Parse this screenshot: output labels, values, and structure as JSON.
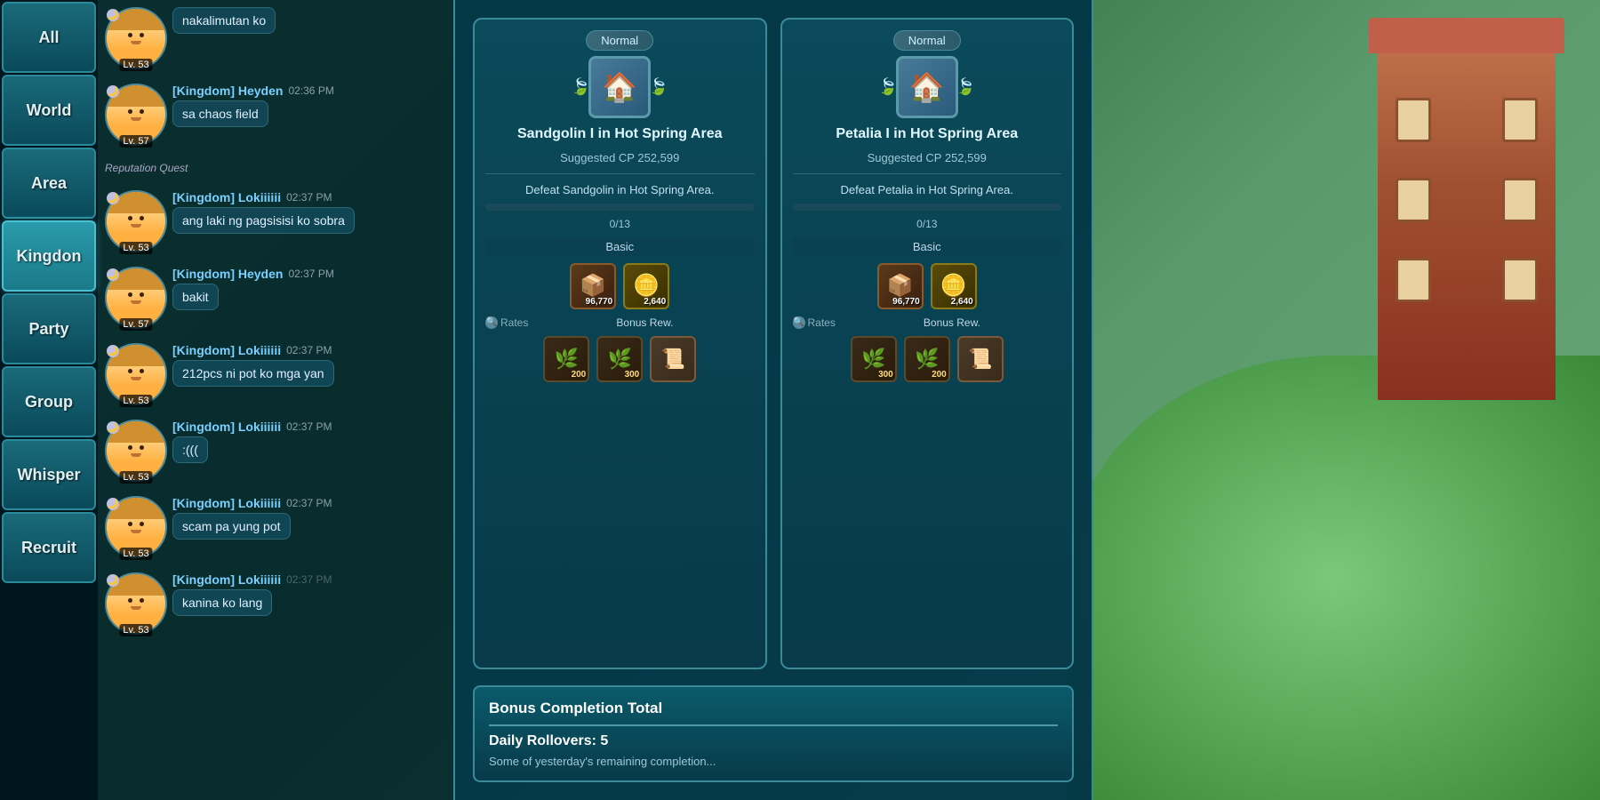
{
  "game_bg": {
    "description": "Fantasy game world background with grass and buildings"
  },
  "chat_tabs": [
    {
      "id": "all",
      "label": "All",
      "active": false
    },
    {
      "id": "world",
      "label": "World",
      "active": false
    },
    {
      "id": "area",
      "label": "Area",
      "active": false
    },
    {
      "id": "kingdom",
      "label": "Kingdon",
      "active": true
    },
    {
      "id": "party",
      "label": "Party",
      "active": false
    },
    {
      "id": "group",
      "label": "Group",
      "active": false
    },
    {
      "id": "whisper",
      "label": "Whisper",
      "active": false
    },
    {
      "id": "recruit",
      "label": "Recruit",
      "active": false
    }
  ],
  "chat_messages": [
    {
      "id": 1,
      "avatar_level": "Lv. 53",
      "message_text": "nakalimutan ko",
      "time": ""
    },
    {
      "id": 2,
      "name": "[Kingdom] Heyden",
      "avatar_level": "Lv. 57",
      "message_text": "sa chaos field",
      "time": "02:36 PM"
    },
    {
      "id": 3,
      "system_text": "Reputation Quest"
    },
    {
      "id": 4,
      "name": "[Kingdom] Lokiiiiii",
      "avatar_level": "Lv. 53",
      "message_text": "ang laki ng pagsisisi ko sobra",
      "time": "02:37 PM"
    },
    {
      "id": 5,
      "name": "[Kingdom] Heyden",
      "avatar_level": "Lv. 57",
      "message_text": "bakit",
      "time": "02:37 PM"
    },
    {
      "id": 6,
      "name": "[Kingdom] Lokiiiiii",
      "avatar_level": "Lv. 53",
      "message_text": "212pcs ni pot ko mga yan",
      "time": "02:37 PM"
    },
    {
      "id": 7,
      "name": "[Kingdom] Lokiiiiii",
      "avatar_level": "Lv. 53",
      "message_text": ":(((",
      "time": "02:37 PM"
    },
    {
      "id": 8,
      "name": "[Kingdom] Lokiiiiii",
      "avatar_level": "Lv. 53",
      "message_text": "scam pa yung pot",
      "time": "02:37 PM"
    },
    {
      "id": 9,
      "name": "[Kingdom] Lokiiiiii",
      "avatar_level": "Lv. 53",
      "message_text": "kanina ko lang",
      "time": "02:37 PM",
      "partial": true
    }
  ],
  "quest_panel": {
    "quest1": {
      "badge": "Normal",
      "title": "Sandgolin I in Hot Spring Area",
      "cp": "Suggested CP 252,599",
      "description": "Defeat Sandgolin in Hot Spring Area.",
      "progress_current": 0,
      "progress_max": 13,
      "progress_text": "0/13",
      "basic_label": "Basic",
      "rewards": [
        {
          "type": "exp",
          "icon": "📦",
          "count": "96,770"
        },
        {
          "type": "gold",
          "icon": "🪙",
          "count": "2,640"
        }
      ],
      "rates_label": "Rates",
      "bonus_rew_label": "Bonus Rew.",
      "bonus_rewards": [
        {
          "icon": "🌿",
          "count": "200"
        },
        {
          "icon": "🌿",
          "count": "300"
        },
        {
          "icon": "📜",
          "count": ""
        }
      ]
    },
    "quest2": {
      "badge": "Normal",
      "title": "Petalia I in Hot Spring Area",
      "cp": "Suggested CP 252,599",
      "description": "Defeat Petalia in Hot Spring Area.",
      "progress_current": 0,
      "progress_max": 13,
      "progress_text": "0/13",
      "basic_label": "Basic",
      "rewards": [
        {
          "type": "exp",
          "icon": "📦",
          "count": "96,770"
        },
        {
          "type": "gold",
          "icon": "🪙",
          "count": "2,640"
        }
      ],
      "rates_label": "Rates",
      "bonus_rew_label": "Bonus Rew.",
      "bonus_rewards": [
        {
          "icon": "🌿",
          "count": "300"
        },
        {
          "icon": "🌿",
          "count": "200"
        },
        {
          "icon": "📜",
          "count": ""
        }
      ]
    }
  },
  "bonus_completion": {
    "title": "Bonus Completion Total",
    "rollovers_label": "Daily Rollovers: 5",
    "note": "Some of yesterday's remaining completion..."
  }
}
